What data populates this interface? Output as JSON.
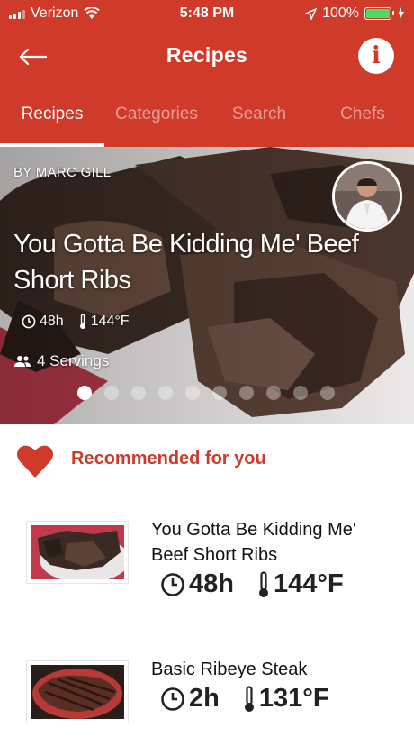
{
  "status_bar": {
    "carrier": "Verizon",
    "time": "5:48 PM",
    "battery": "100%",
    "battery_level": 1.0
  },
  "nav": {
    "title": "Recipes",
    "back_icon": "arrow-left-icon",
    "info_icon": "info-icon"
  },
  "tabs": [
    {
      "label": "Recipes",
      "active": true
    },
    {
      "label": "Categories",
      "active": false
    },
    {
      "label": "Search",
      "active": false
    },
    {
      "label": "Chefs",
      "active": false
    }
  ],
  "featured": {
    "byline": "BY MARC GILL",
    "title": "You Gotta Be Kidding Me' Beef Short Ribs",
    "time": "48h",
    "temperature": "144°F",
    "servings": "4 Servings",
    "carousel": {
      "count": 10,
      "active_index": 0
    }
  },
  "recommended": {
    "heading": "Recommended for you",
    "items": [
      {
        "title": "You Gotta Be Kidding Me' Beef Short Ribs",
        "time": "48h",
        "temperature": "144°F"
      },
      {
        "title": "Basic Ribeye Steak",
        "time": "2h",
        "temperature": "131°F"
      }
    ]
  },
  "colors": {
    "brand": "#cf3a2b",
    "text": "#222222",
    "inactive_tab": "rgba(255,255,255,0.5)"
  }
}
